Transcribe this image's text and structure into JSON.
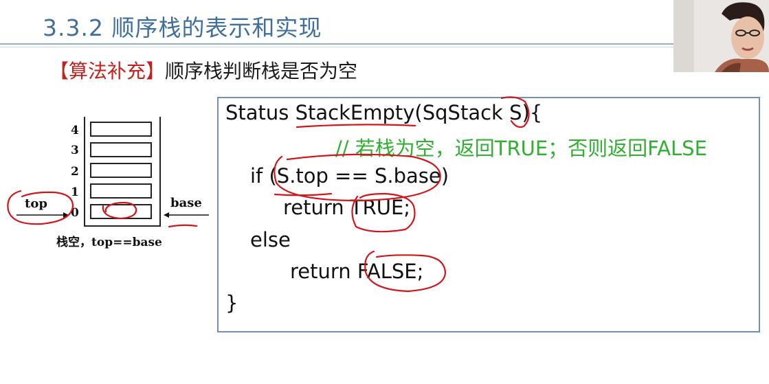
{
  "slide": {
    "title": "3.3.2 顺序栈的表示和实现",
    "subtitle_tag": "【算法补充】",
    "subtitle_text": "顺序栈判断栈是否为空"
  },
  "diagram": {
    "indices": [
      "4",
      "3",
      "2",
      "1",
      "0"
    ],
    "top_label": "top",
    "base_label": "base",
    "caption": "栈空，top==base"
  },
  "code": {
    "lines": [
      "Status StackEmpty(SqStack S){",
      "// 若栈为空，返回TRUE；否则返回FALSE",
      "if (S.top == S.base)",
      "return TRUE;",
      "else",
      "return  FALSE;",
      "}"
    ]
  },
  "colors": {
    "title": "#3f6f9a",
    "tag": "#c0231d",
    "comment": "#2fb12f",
    "code_border": "#6f8fb3",
    "annotation_ink": "#d4141b"
  }
}
